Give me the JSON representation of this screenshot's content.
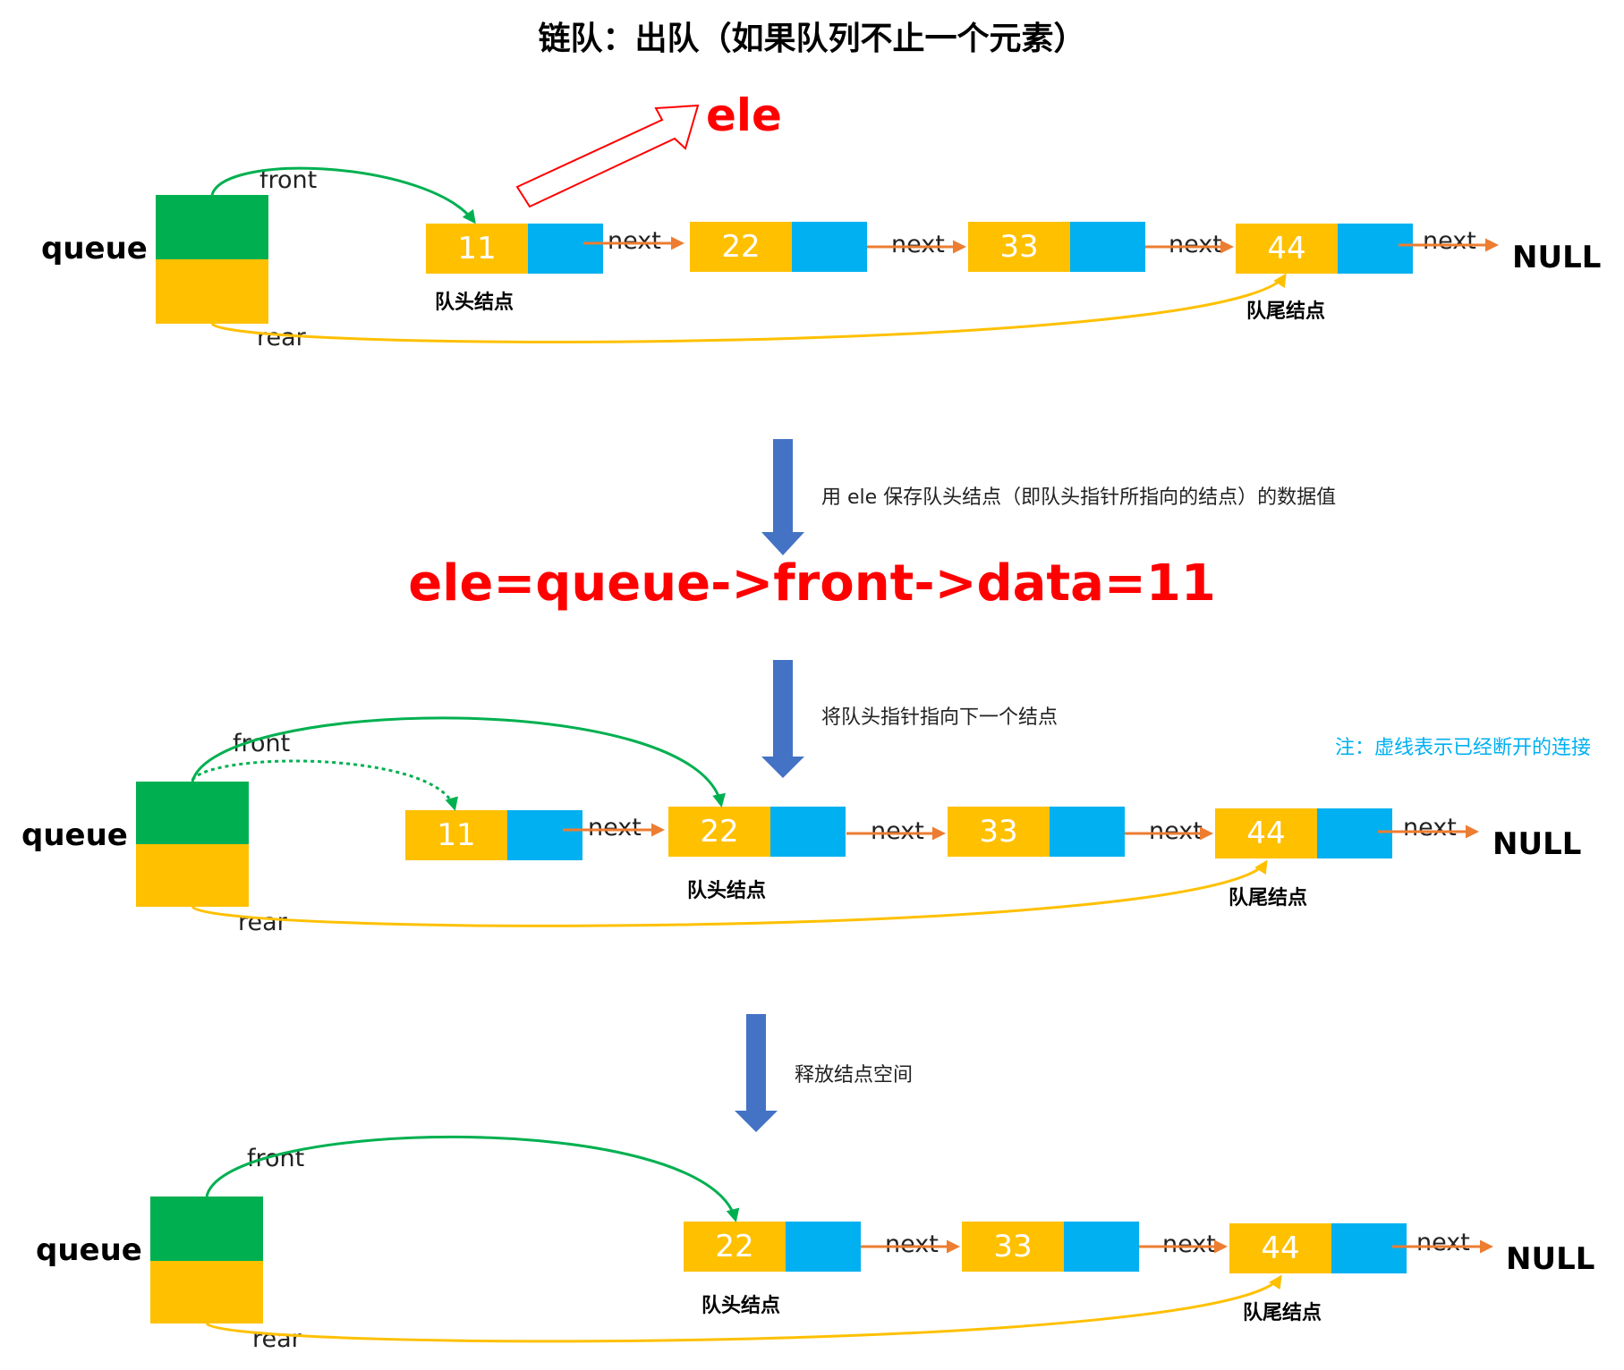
{
  "title": "链队：出队（如果队列不止一个元素）",
  "queue_label": "queue",
  "front_label": "front",
  "rear_label": "rear",
  "next_label": "next",
  "null_label": "NULL",
  "head_caption": "队头结点",
  "tail_caption": "队尾结点",
  "ele_label": "ele",
  "step1": "用 ele 保存队头结点（即队头指针所指向的结点）的数据值",
  "formula": "ele=queue->front->data=11",
  "step2": "将队头指针指向下一个结点",
  "note": "注：虚线表示已经断开的连接",
  "step3": "释放结点空间",
  "diagram1": {
    "nodes": [
      "11",
      "22",
      "33",
      "44"
    ]
  },
  "diagram2": {
    "nodes": [
      "11",
      "22",
      "33",
      "44"
    ]
  },
  "diagram3": {
    "nodes": [
      "22",
      "33",
      "44"
    ]
  },
  "colors": {
    "data_cell": "#ffc000",
    "next_cell": "#00b0f0",
    "queue_front": "#00b050",
    "queue_rear": "#ffc000",
    "front_arrow": "#00b050",
    "rear_arrow": "#ffc000",
    "next_arrow": "#ed7d31",
    "step_arrow": "#4472c4",
    "highlight": "#ff0000",
    "note": "#00b0f0"
  }
}
